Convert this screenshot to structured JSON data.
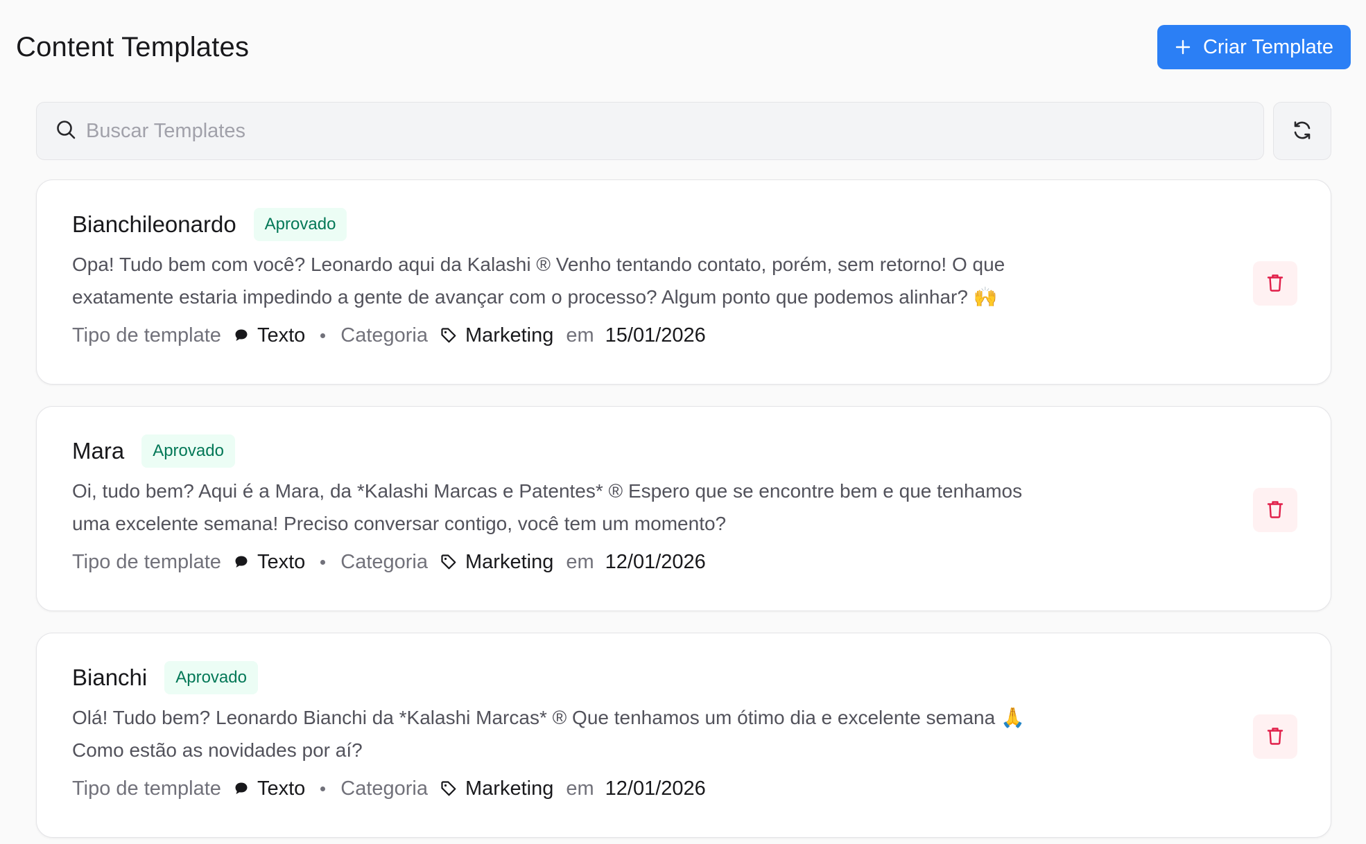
{
  "header": {
    "title": "Content Templates",
    "create_button_label": "Criar Template"
  },
  "search": {
    "placeholder": "Buscar Templates",
    "value": ""
  },
  "colors": {
    "primary": "#2b7ff5",
    "badge_bg": "#ecfdf5",
    "badge_text": "#047857",
    "delete_bg": "#fff1f2",
    "delete_icon": "#e11d48"
  },
  "icons": {
    "create": "plus-icon",
    "search": "search-icon",
    "refresh": "refresh-icon",
    "type": "chat-bubble-icon",
    "category": "tag-icon",
    "delete": "trash-icon"
  },
  "meta_labels": {
    "type_label": "Tipo de template",
    "category_label": "Categoria",
    "date_prefix": "em"
  },
  "templates": [
    {
      "name": "Bianchileonardo",
      "status": "Aprovado",
      "body": "Opa! Tudo bem com você? Leonardo aqui da Kalashi ® Venho tentando contato, porém, sem retorno! O que\nexatamente estaria impedindo a gente de avançar com o processo? Algum ponto que podemos alinhar? 🙌",
      "type": "Texto",
      "category": "Marketing",
      "date": "15/01/2026"
    },
    {
      "name": "Mara",
      "status": "Aprovado",
      "body": "Oi, tudo bem? Aqui é a Mara, da *Kalashi Marcas e Patentes* ® Espero que se encontre bem e que tenhamos\numa excelente semana! Preciso conversar contigo, você tem um momento?",
      "type": "Texto",
      "category": "Marketing",
      "date": "12/01/2026"
    },
    {
      "name": "Bianchi",
      "status": "Aprovado",
      "body": "Olá! Tudo bem? Leonardo Bianchi da *Kalashi Marcas* ®   Que tenhamos um ótimo dia e excelente semana 🙏\nComo estão as novidades por aí?",
      "type": "Texto",
      "category": "Marketing",
      "date": "12/01/2026"
    }
  ]
}
